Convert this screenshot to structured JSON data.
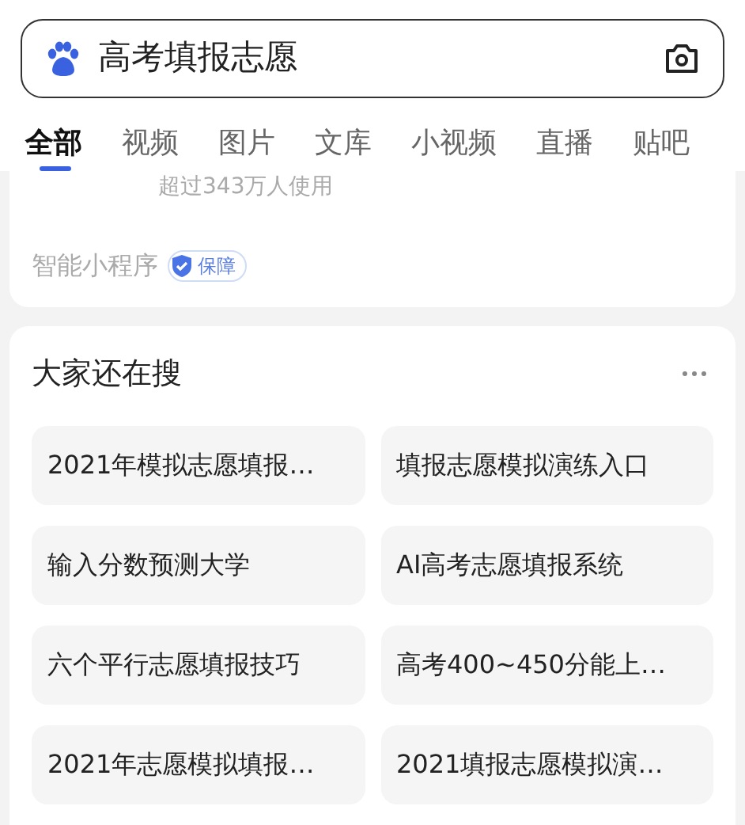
{
  "search": {
    "value": "高考填报志愿"
  },
  "tabs": [
    {
      "label": "全部",
      "selected": true
    },
    {
      "label": "视频",
      "selected": false
    },
    {
      "label": "图片",
      "selected": false
    },
    {
      "label": "文库",
      "selected": false
    },
    {
      "label": "小视频",
      "selected": false
    },
    {
      "label": "直播",
      "selected": false
    },
    {
      "label": "贴吧",
      "selected": false
    }
  ],
  "result_card": {
    "users": "超过343万人使用",
    "source": "智能小程序",
    "badge": "保障"
  },
  "related": {
    "title": "大家还在搜",
    "items": [
      "2021年模拟志愿填报…",
      "填报志愿模拟演练入口",
      "输入分数预测大学",
      "AI高考志愿填报系统",
      "六个平行志愿填报技巧",
      "高考400~450分能上…",
      "2021年志愿模拟填报…",
      "2021填报志愿模拟演…"
    ]
  }
}
